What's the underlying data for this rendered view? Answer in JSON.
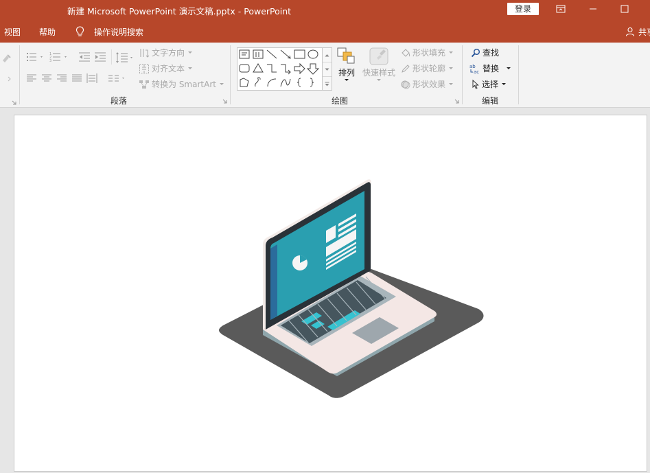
{
  "window": {
    "title": "新建 Microsoft PowerPoint 演示文稿.pptx  -  PowerPoint",
    "login_label": "登录"
  },
  "menu": {
    "view": "视图",
    "help": "帮助",
    "tell_me": "操作说明搜索",
    "share": "共享"
  },
  "ribbon": {
    "paragraph": {
      "label": "段落",
      "text_direction": "文字方向",
      "align_text": "对齐文本",
      "convert_smartart": "转换为 SmartArt"
    },
    "drawing": {
      "label": "绘图",
      "arrange": "排列",
      "quick_styles": "快速样式",
      "shape_fill": "形状填充",
      "shape_outline": "形状轮廓",
      "shape_effects": "形状效果"
    },
    "editing": {
      "label": "编辑",
      "find": "查找",
      "replace": "替换",
      "select": "选择"
    }
  },
  "colors": {
    "accent": "#b7472a",
    "ribbon_bg": "#f3f3f3",
    "laptop_screen": "#2a9fb0",
    "laptop_shadow": "#5a5a5a"
  },
  "icons": {
    "tell_me": "lightbulb-icon",
    "share": "person-icon",
    "find": "magnifier-icon",
    "replace": "replace-icon",
    "select": "cursor-icon"
  }
}
